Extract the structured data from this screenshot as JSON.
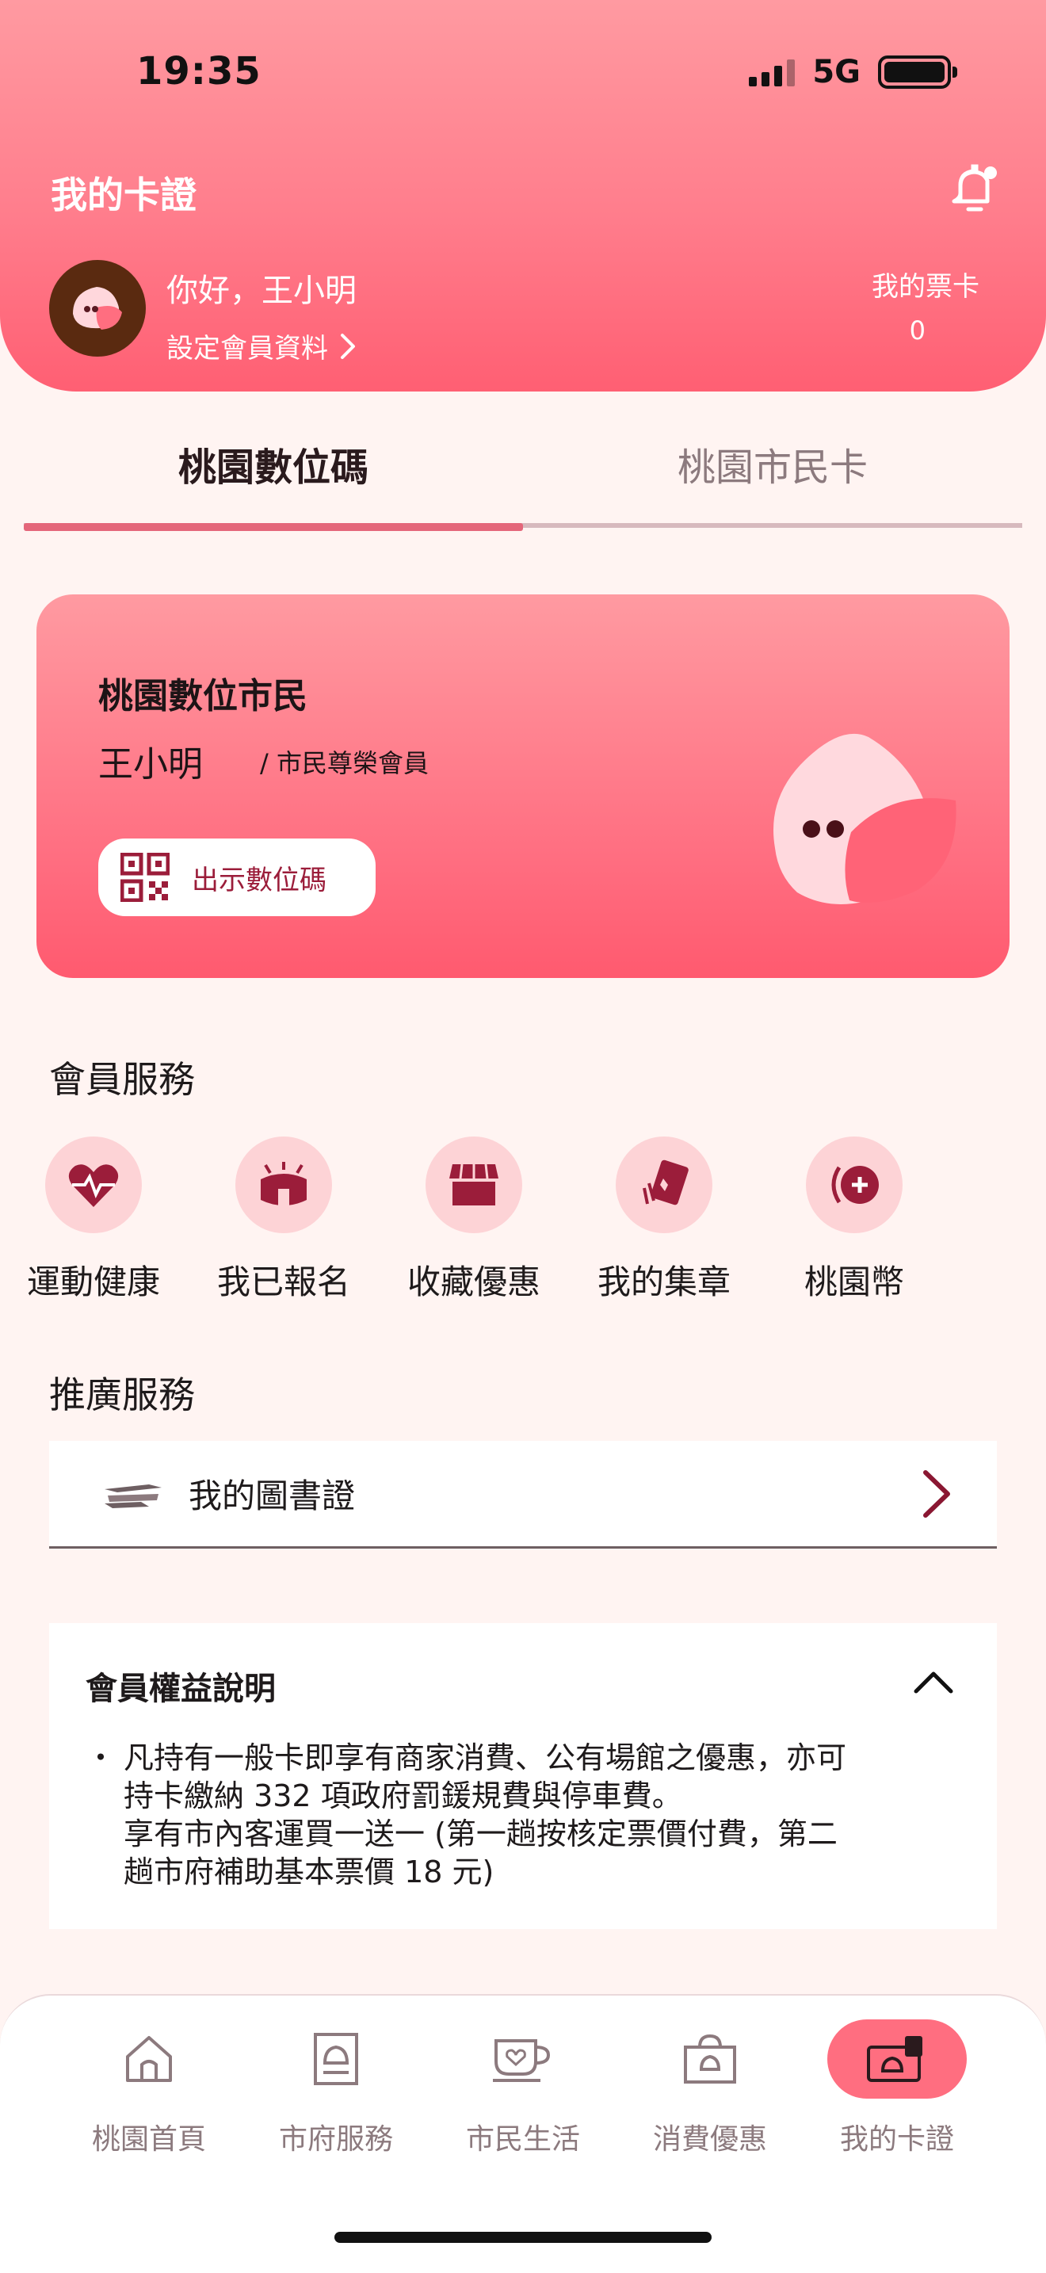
{
  "status_bar": {
    "time": "19:35",
    "network": "5G"
  },
  "header": {
    "title": "我的卡證",
    "greeting": "你好，王小明",
    "profile_link": "設定會員資料",
    "ticket_label": "我的票卡",
    "ticket_count": "0"
  },
  "tabs": [
    {
      "label": "桃園數位碼",
      "active": true
    },
    {
      "label": "桃園市民卡",
      "active": false
    }
  ],
  "member_card": {
    "title": "桃園數位市民",
    "name": "王小明",
    "level": "/ 市民尊榮會員",
    "qr_button": "出示數位碼"
  },
  "member_services": {
    "title": "會員服務",
    "items": [
      {
        "label": "運動健康",
        "icon": "heart-pulse-icon"
      },
      {
        "label": "我已報名",
        "icon": "stadium-icon"
      },
      {
        "label": "收藏優惠",
        "icon": "shop-icon"
      },
      {
        "label": "我的集章",
        "icon": "stamp-card-icon"
      },
      {
        "label": "桃園幣",
        "icon": "coin-plus-icon"
      }
    ]
  },
  "promo_services": {
    "title": "推廣服務",
    "items": [
      {
        "label": "我的圖書證",
        "icon": "books-icon"
      }
    ]
  },
  "benefits": {
    "title": "會員權益說明",
    "bullet": "・",
    "text": "凡持有一般卡即享有商家消費、公有場館之優惠，亦可\n持卡繳納 332 項政府罰鍰規費與停車費。\n享有市內客運買一送一 (第一趟按核定票價付費，第二\n趟市府補助基本票價 18 元)"
  },
  "bottom_nav": [
    {
      "label": "桃園首頁",
      "icon": "home-icon",
      "active": false
    },
    {
      "label": "市府服務",
      "icon": "city-hall-icon",
      "active": false
    },
    {
      "label": "市民生活",
      "icon": "coffee-cup-icon",
      "active": false
    },
    {
      "label": "消費優惠",
      "icon": "shopping-bag-icon",
      "active": false
    },
    {
      "label": "我的卡證",
      "icon": "card-wallet-icon",
      "active": true
    }
  ],
  "colors": {
    "accent": "#ff6e80",
    "brand_dark": "#9b1d3a",
    "background": "#fff4f2"
  }
}
